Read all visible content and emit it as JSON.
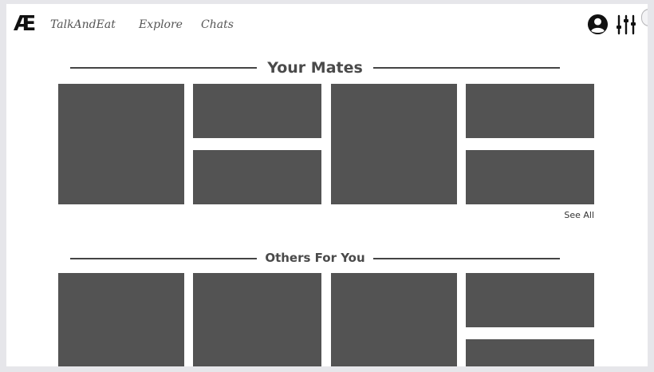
{
  "navbar": {
    "logo_text": "Æ",
    "links": [
      "TalkAndEat",
      "Explore",
      "Chats"
    ],
    "profile_icon": "user-circle-icon",
    "filter_icon": "sliders-icon"
  },
  "sections": {
    "mates": {
      "title": "Your Mates",
      "see_all": "See All"
    },
    "others": {
      "title": "Others For You"
    }
  },
  "colors": {
    "tile": "#535353",
    "background": "#ffffff",
    "frame": "#e6e6ea"
  }
}
